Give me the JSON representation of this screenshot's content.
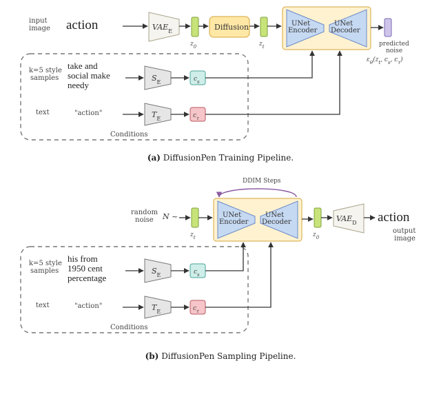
{
  "figureA": {
    "caption_key": "(a)",
    "caption_text": "DiffusionPen Training Pipeline.",
    "input_label": "input\nimage",
    "input_hand": "action",
    "vae_e": "VAE_E",
    "z0": "z₀",
    "diffusion": "Diffusion",
    "zt": "z_t",
    "unet_enc": "UNet\nEncoder",
    "unet_dec": "UNet\nDecoder",
    "pred_label": "predicted\nnoise",
    "pred_math": "ε_θ(z_t, c_s, c_τ)",
    "cond_box_label": "Conditions",
    "style_label": "k=5 style\nsamples",
    "style_hand": "take and\nsocial make\nneedy",
    "se": "S_E",
    "cs": "c_s",
    "text_label": "text",
    "text_value": "\"action\"",
    "te": "T_E",
    "ctau": "c_τ"
  },
  "figureB": {
    "caption_key": "(b)",
    "caption_text": "DiffusionPen Sampling Pipeline.",
    "noise_label": "random\nnoise",
    "noise_sym": "N ~",
    "zt": "z_t",
    "ddim": "DDIM Steps",
    "unet_enc": "UNet\nEncoder",
    "unet_dec": "UNet\nDecoder",
    "z0": "z₀",
    "vae_d": "VAE_D",
    "output_hand": "action",
    "output_label": "output\nimage",
    "cond_box_label": "Conditions",
    "style_label": "k=5 style\nsamples",
    "style_hand": "his from\n1950 cent\npercentage",
    "se": "S_E",
    "cs": "c_s",
    "text_label": "text",
    "text_value": "\"action\"",
    "te": "T_E",
    "ctau": "c_τ"
  },
  "colors": {
    "dashed": "#777",
    "vae_fill": "#f6f4ef",
    "vae_stroke": "#a8a38b",
    "lime": "#c7e37a",
    "lime_stroke": "#7fa23e",
    "diffusion_fill": "#ffe8a6",
    "diffusion_stroke": "#d6a53a",
    "unet_box_fill": "#fff2d0",
    "unet_box_stroke": "#d6a53a",
    "unet_tri_fill": "#c6d9f2",
    "unet_tri_stroke": "#6b8bc7",
    "purple": "#cfc4ea",
    "purple_stroke": "#7a6bb0",
    "se_fill": "#e6e6e6",
    "se_stroke": "#777",
    "cs_fill": "#cfeee9",
    "cs_stroke": "#49a49a",
    "te_fill": "#e6e6e6",
    "te_stroke": "#777",
    "ctau_fill": "#f6c5c9",
    "ctau_stroke": "#b85a62",
    "ddim": "#8a5aa3"
  }
}
